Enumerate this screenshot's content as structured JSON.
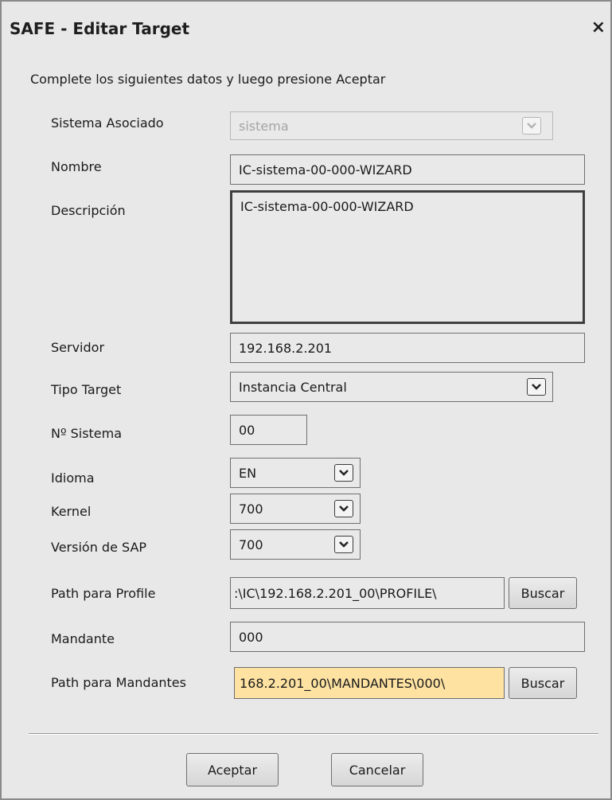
{
  "dialog": {
    "title": "SAFE - Editar Target",
    "close_symbol": "×",
    "instructions": "Complete los siguientes datos y luego presione Aceptar"
  },
  "form": {
    "sistema_asociado": {
      "label": "Sistema Asociado",
      "value": "sistema",
      "disabled": true
    },
    "nombre": {
      "label": "Nombre",
      "value": "IC-sistema-00-000-WIZARD"
    },
    "descripcion": {
      "label": "Descripción",
      "value": "IC-sistema-00-000-WIZARD"
    },
    "servidor": {
      "label": "Servidor",
      "value": "192.168.2.201"
    },
    "tipo_target": {
      "label": "Tipo Target",
      "value": "Instancia Central"
    },
    "n_sistema": {
      "label": "Nº Sistema",
      "value": "00"
    },
    "idioma": {
      "label": "Idioma",
      "value": "EN"
    },
    "kernel": {
      "label": "Kernel",
      "value": "700"
    },
    "version_sap": {
      "label": "Versión de SAP",
      "value": "700"
    },
    "path_profile": {
      "label": "Path para Profile",
      "value": ":\\IC\\192.168.2.201_00\\PROFILE\\",
      "button": "Buscar"
    },
    "mandante": {
      "label": "Mandante",
      "value": "000"
    },
    "path_mandantes": {
      "label": "Path para Mandantes",
      "value": "168.2.201_00\\MANDANTES\\000\\",
      "button": "Buscar",
      "highlight_color": "#fde2a2"
    }
  },
  "footer": {
    "accept_label": "Aceptar",
    "cancel_label": "Cancelar"
  },
  "icons": {
    "dropdown": "chevron-down-icon",
    "close": "close-icon"
  }
}
